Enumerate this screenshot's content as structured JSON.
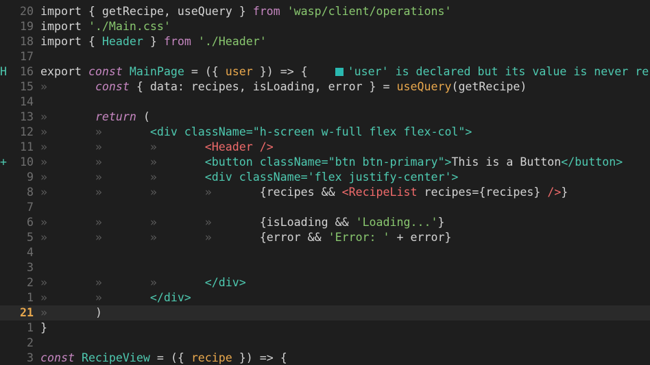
{
  "editor": {
    "colors": {
      "background": "#1e1e1e",
      "keyword": "#c586c0",
      "string": "#89c76f",
      "tag": "#4ec9b0",
      "component": "#f06b6b",
      "variable": "#e9a84d",
      "cursor_line_number": "#e9a84d"
    },
    "lines": [
      {
        "sign": "",
        "num": "20",
        "current": false,
        "tokens": [
          [
            "p",
            "import { getRecipe, useQuery } "
          ],
          [
            "kw",
            "from"
          ],
          [
            "p",
            " "
          ],
          [
            "str",
            "'wasp/client/operations'"
          ]
        ]
      },
      {
        "sign": "",
        "num": "19",
        "current": false,
        "tokens": [
          [
            "p",
            "import "
          ],
          [
            "str",
            "'./Main.css'"
          ]
        ]
      },
      {
        "sign": "",
        "num": "18",
        "current": false,
        "tokens": [
          [
            "p",
            "import { "
          ],
          [
            "tag",
            "Header"
          ],
          [
            "p",
            " } "
          ],
          [
            "kw",
            "from"
          ],
          [
            "p",
            " "
          ],
          [
            "str",
            "'./Header'"
          ]
        ]
      },
      {
        "sign": "",
        "num": "17",
        "current": false,
        "tokens": []
      },
      {
        "sign": "H",
        "num": "16",
        "current": false,
        "tokens": [
          [
            "p",
            "export "
          ],
          [
            "kwi",
            "const"
          ],
          [
            "p",
            " "
          ],
          [
            "tag",
            "MainPage"
          ],
          [
            "p",
            " = ({ "
          ],
          [
            "var",
            "user"
          ],
          [
            "p",
            " }) => {"
          ]
        ],
        "diagnostic": "'user' is declared but its value is never re"
      },
      {
        "sign": "",
        "num": "15",
        "current": false,
        "tokens": [
          [
            "ind",
            "»       "
          ],
          [
            "kwi",
            "const"
          ],
          [
            "p",
            " { data: recipes, isLoading, error } = "
          ],
          [
            "var",
            "useQuery"
          ],
          [
            "p",
            "(getRecipe)"
          ]
        ]
      },
      {
        "sign": "",
        "num": "14",
        "current": false,
        "tokens": []
      },
      {
        "sign": "",
        "num": "13",
        "current": false,
        "tokens": [
          [
            "ind",
            "»       "
          ],
          [
            "kwi",
            "return"
          ],
          [
            "p",
            " ("
          ]
        ]
      },
      {
        "sign": "",
        "num": "12",
        "current": false,
        "tokens": [
          [
            "ind",
            "»       »       "
          ],
          [
            "tag",
            "<div className=\"h-screen w-full flex flex-col\">"
          ]
        ]
      },
      {
        "sign": "",
        "num": "11",
        "current": false,
        "tokens": [
          [
            "ind",
            "»       »       »       "
          ],
          [
            "comp",
            "<Header />"
          ]
        ]
      },
      {
        "sign": "+",
        "num": "10",
        "current": false,
        "tokens": [
          [
            "ind",
            "»       »       »       "
          ],
          [
            "tag",
            "<button className=\"btn btn-primary\">"
          ],
          [
            "p",
            "This is a Button"
          ],
          [
            "tag",
            "</button>"
          ]
        ]
      },
      {
        "sign": "",
        "num": "9",
        "current": false,
        "tokens": [
          [
            "ind",
            "»       »       »       "
          ],
          [
            "tag",
            "<div className='flex justify-center'>"
          ]
        ]
      },
      {
        "sign": "",
        "num": "8",
        "current": false,
        "tokens": [
          [
            "ind",
            "»       »       »       »       "
          ],
          [
            "p",
            "{recipes && "
          ],
          [
            "comp",
            "<RecipeList"
          ],
          [
            "p",
            " recipes={recipes} "
          ],
          [
            "comp",
            "/>"
          ],
          [
            "p",
            "}"
          ]
        ]
      },
      {
        "sign": "",
        "num": "7",
        "current": false,
        "tokens": []
      },
      {
        "sign": "",
        "num": "6",
        "current": false,
        "tokens": [
          [
            "ind",
            "»       »       »       »       "
          ],
          [
            "p",
            "{isLoading && "
          ],
          [
            "str",
            "'Loading...'"
          ],
          [
            "p",
            "}"
          ]
        ]
      },
      {
        "sign": "",
        "num": "5",
        "current": false,
        "tokens": [
          [
            "ind",
            "»       »       »       »       "
          ],
          [
            "p",
            "{error && "
          ],
          [
            "str",
            "'Error: '"
          ],
          [
            "p",
            " + error}"
          ]
        ]
      },
      {
        "sign": "",
        "num": "4",
        "current": false,
        "tokens": []
      },
      {
        "sign": "",
        "num": "3",
        "current": false,
        "tokens": []
      },
      {
        "sign": "",
        "num": "2",
        "current": false,
        "tokens": [
          [
            "ind",
            "»       »       »       "
          ],
          [
            "tag",
            "</div>"
          ]
        ]
      },
      {
        "sign": "",
        "num": "1",
        "current": false,
        "tokens": [
          [
            "ind",
            "»       »       "
          ],
          [
            "tag",
            "</div>"
          ]
        ]
      },
      {
        "sign": "",
        "num": "21",
        "current": true,
        "tokens": [
          [
            "ind",
            "»       "
          ],
          [
            "p",
            ")"
          ]
        ]
      },
      {
        "sign": "",
        "num": "1",
        "current": false,
        "tokens": [
          [
            "p",
            "}"
          ]
        ]
      },
      {
        "sign": "",
        "num": "2",
        "current": false,
        "tokens": []
      },
      {
        "sign": "",
        "num": "3",
        "current": false,
        "tokens": [
          [
            "kwi",
            "const"
          ],
          [
            "p",
            " "
          ],
          [
            "tag",
            "RecipeView"
          ],
          [
            "p",
            " = ({ "
          ],
          [
            "var",
            "recipe"
          ],
          [
            "p",
            " }) => {"
          ]
        ]
      }
    ]
  }
}
